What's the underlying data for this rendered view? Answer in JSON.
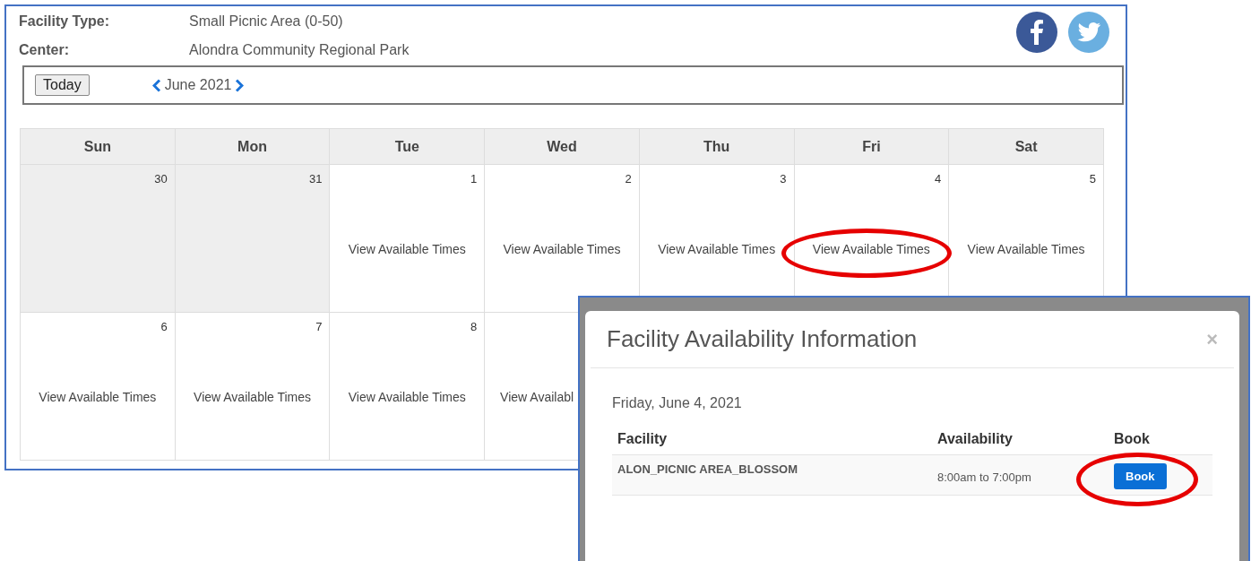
{
  "facility_info": [
    {
      "label": "Facility Type:",
      "value": "Small Picnic Area (0-50)"
    },
    {
      "label": "Center:",
      "value": "Alondra Community Regional Park"
    }
  ],
  "toolbar": {
    "today_button": "Today",
    "month": "June 2021"
  },
  "calendar": {
    "weekdays": [
      "Sun",
      "Mon",
      "Tue",
      "Wed",
      "Thu",
      "Fri",
      "Sat"
    ],
    "weeks": [
      [
        {
          "day": "30",
          "past": true
        },
        {
          "day": "31",
          "past": true
        },
        {
          "day": "1",
          "past": false,
          "link": "View Available Times"
        },
        {
          "day": "2",
          "past": false,
          "link": "View Available Times"
        },
        {
          "day": "3",
          "past": false,
          "link": "View Available Times"
        },
        {
          "day": "4",
          "past": false,
          "link": "View Available Times",
          "circled": true
        },
        {
          "day": "5",
          "past": false,
          "link": "View Available Times"
        }
      ],
      [
        {
          "day": "6",
          "past": false,
          "link": "View Available Times"
        },
        {
          "day": "7",
          "past": false,
          "link": "View Available Times"
        },
        {
          "day": "8",
          "past": false,
          "link": "View Available Times"
        },
        {
          "past": false,
          "link": "View Availabl"
        }
      ]
    ]
  },
  "modal": {
    "title": "Facility Availability Information",
    "close": "×",
    "date": "Friday, June 4, 2021",
    "columns": [
      "Facility",
      "Availability",
      "Book"
    ],
    "rows": [
      {
        "facility": "ALON_PICNIC AREA_BLOSSOM",
        "availability": "8:00am to 7:00pm",
        "book": "Book",
        "circled": true
      }
    ]
  }
}
